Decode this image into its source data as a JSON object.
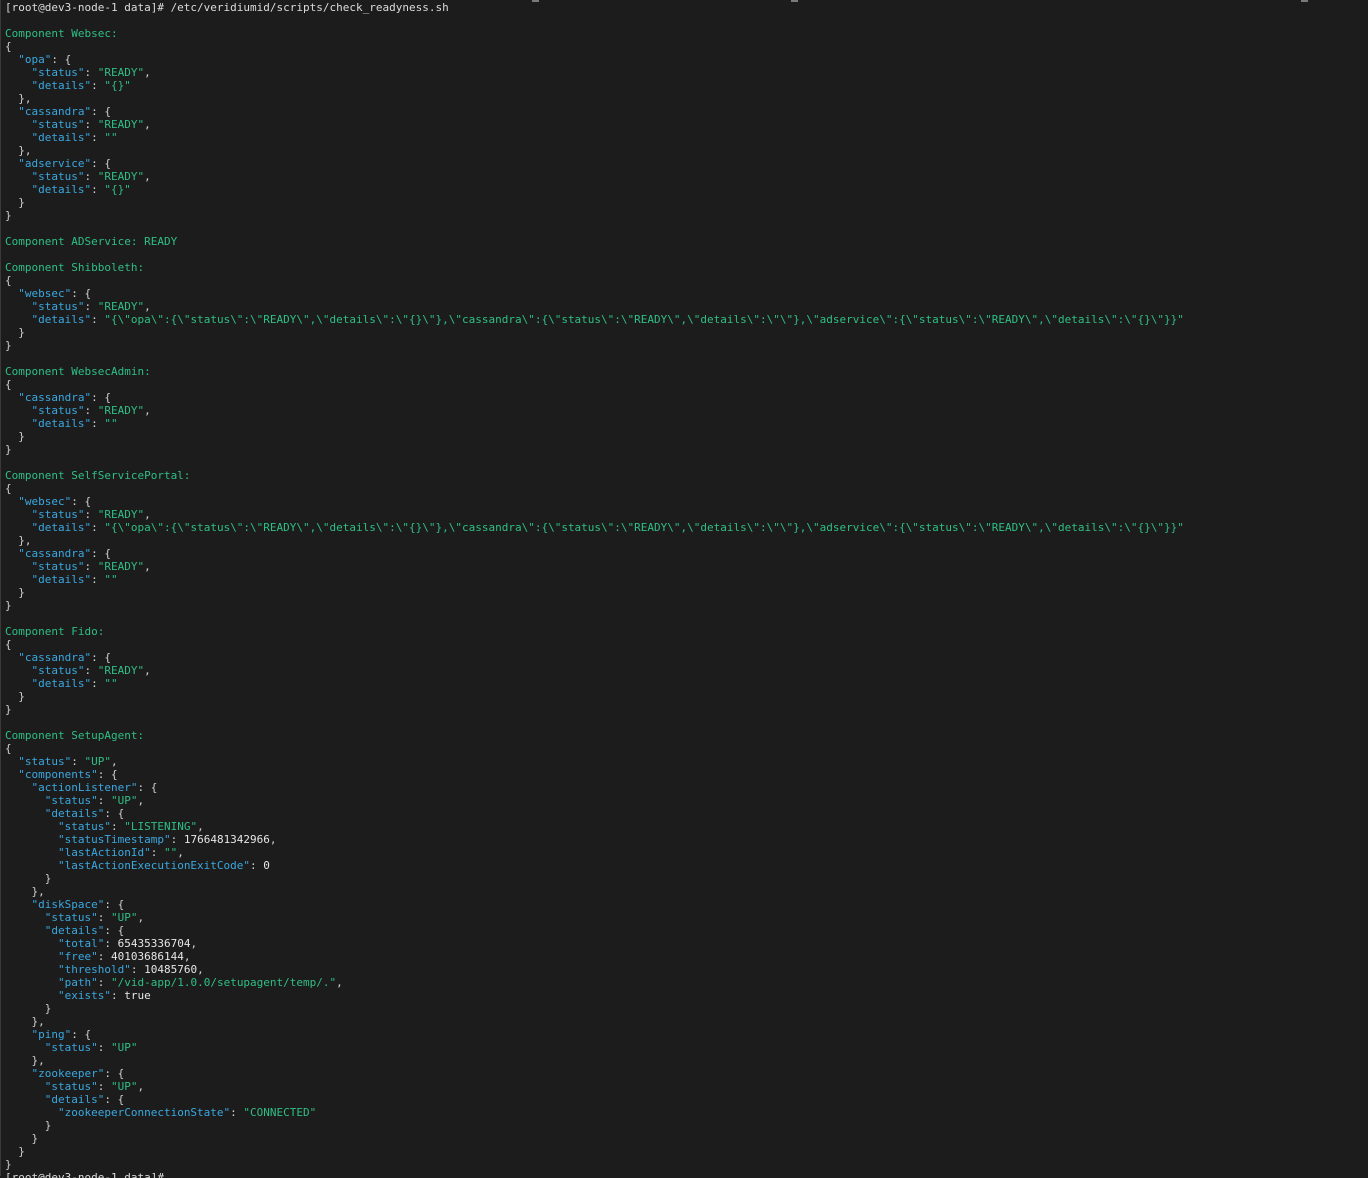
{
  "terminal": {
    "lines": [
      [
        [
          "prompt",
          "[root@dev3-node-1 data]# /etc/veridiumid/scripts/check_readyness.sh"
        ]
      ],
      [],
      [
        [
          "c",
          "Component Websec:"
        ]
      ],
      [
        [
          "p",
          "{"
        ]
      ],
      [
        [
          "p",
          "  "
        ],
        [
          "k",
          "\"opa\""
        ],
        [
          "p",
          ": {"
        ]
      ],
      [
        [
          "p",
          "    "
        ],
        [
          "k",
          "\"status\""
        ],
        [
          "p",
          ": "
        ],
        [
          "s",
          "\"READY\""
        ],
        [
          "p",
          ","
        ]
      ],
      [
        [
          "p",
          "    "
        ],
        [
          "k",
          "\"details\""
        ],
        [
          "p",
          ": "
        ],
        [
          "s",
          "\"{}\""
        ]
      ],
      [
        [
          "p",
          "  },"
        ]
      ],
      [
        [
          "p",
          "  "
        ],
        [
          "k",
          "\"cassandra\""
        ],
        [
          "p",
          ": {"
        ]
      ],
      [
        [
          "p",
          "    "
        ],
        [
          "k",
          "\"status\""
        ],
        [
          "p",
          ": "
        ],
        [
          "s",
          "\"READY\""
        ],
        [
          "p",
          ","
        ]
      ],
      [
        [
          "p",
          "    "
        ],
        [
          "k",
          "\"details\""
        ],
        [
          "p",
          ": "
        ],
        [
          "s",
          "\"\""
        ]
      ],
      [
        [
          "p",
          "  },"
        ]
      ],
      [
        [
          "p",
          "  "
        ],
        [
          "k",
          "\"adservice\""
        ],
        [
          "p",
          ": {"
        ]
      ],
      [
        [
          "p",
          "    "
        ],
        [
          "k",
          "\"status\""
        ],
        [
          "p",
          ": "
        ],
        [
          "s",
          "\"READY\""
        ],
        [
          "p",
          ","
        ]
      ],
      [
        [
          "p",
          "    "
        ],
        [
          "k",
          "\"details\""
        ],
        [
          "p",
          ": "
        ],
        [
          "s",
          "\"{}\""
        ]
      ],
      [
        [
          "p",
          "  }"
        ]
      ],
      [
        [
          "p",
          "}"
        ]
      ],
      [],
      [
        [
          "c",
          "Component ADService: READY"
        ]
      ],
      [],
      [
        [
          "c",
          "Component Shibboleth:"
        ]
      ],
      [
        [
          "p",
          "{"
        ]
      ],
      [
        [
          "p",
          "  "
        ],
        [
          "k",
          "\"websec\""
        ],
        [
          "p",
          ": {"
        ]
      ],
      [
        [
          "p",
          "    "
        ],
        [
          "k",
          "\"status\""
        ],
        [
          "p",
          ": "
        ],
        [
          "s",
          "\"READY\""
        ],
        [
          "p",
          ","
        ]
      ],
      [
        [
          "p",
          "    "
        ],
        [
          "k",
          "\"details\""
        ],
        [
          "p",
          ": "
        ],
        [
          "s",
          "\"{\\\"opa\\\":{\\\"status\\\":\\\"READY\\\",\\\"details\\\":\\\"{}\\\"},\\\"cassandra\\\":{\\\"status\\\":\\\"READY\\\",\\\"details\\\":\\\"\\\"},\\\"adservice\\\":{\\\"status\\\":\\\"READY\\\",\\\"details\\\":\\\"{}\\\"}}\""
        ]
      ],
      [
        [
          "p",
          "  }"
        ]
      ],
      [
        [
          "p",
          "}"
        ]
      ],
      [],
      [
        [
          "c",
          "Component WebsecAdmin:"
        ]
      ],
      [
        [
          "p",
          "{"
        ]
      ],
      [
        [
          "p",
          "  "
        ],
        [
          "k",
          "\"cassandra\""
        ],
        [
          "p",
          ": {"
        ]
      ],
      [
        [
          "p",
          "    "
        ],
        [
          "k",
          "\"status\""
        ],
        [
          "p",
          ": "
        ],
        [
          "s",
          "\"READY\""
        ],
        [
          "p",
          ","
        ]
      ],
      [
        [
          "p",
          "    "
        ],
        [
          "k",
          "\"details\""
        ],
        [
          "p",
          ": "
        ],
        [
          "s",
          "\"\""
        ]
      ],
      [
        [
          "p",
          "  }"
        ]
      ],
      [
        [
          "p",
          "}"
        ]
      ],
      [],
      [
        [
          "c",
          "Component SelfServicePortal:"
        ]
      ],
      [
        [
          "p",
          "{"
        ]
      ],
      [
        [
          "p",
          "  "
        ],
        [
          "k",
          "\"websec\""
        ],
        [
          "p",
          ": {"
        ]
      ],
      [
        [
          "p",
          "    "
        ],
        [
          "k",
          "\"status\""
        ],
        [
          "p",
          ": "
        ],
        [
          "s",
          "\"READY\""
        ],
        [
          "p",
          ","
        ]
      ],
      [
        [
          "p",
          "    "
        ],
        [
          "k",
          "\"details\""
        ],
        [
          "p",
          ": "
        ],
        [
          "s",
          "\"{\\\"opa\\\":{\\\"status\\\":\\\"READY\\\",\\\"details\\\":\\\"{}\\\"},\\\"cassandra\\\":{\\\"status\\\":\\\"READY\\\",\\\"details\\\":\\\"\\\"},\\\"adservice\\\":{\\\"status\\\":\\\"READY\\\",\\\"details\\\":\\\"{}\\\"}}\""
        ]
      ],
      [
        [
          "p",
          "  },"
        ]
      ],
      [
        [
          "p",
          "  "
        ],
        [
          "k",
          "\"cassandra\""
        ],
        [
          "p",
          ": {"
        ]
      ],
      [
        [
          "p",
          "    "
        ],
        [
          "k",
          "\"status\""
        ],
        [
          "p",
          ": "
        ],
        [
          "s",
          "\"READY\""
        ],
        [
          "p",
          ","
        ]
      ],
      [
        [
          "p",
          "    "
        ],
        [
          "k",
          "\"details\""
        ],
        [
          "p",
          ": "
        ],
        [
          "s",
          "\"\""
        ]
      ],
      [
        [
          "p",
          "  }"
        ]
      ],
      [
        [
          "p",
          "}"
        ]
      ],
      [],
      [
        [
          "c",
          "Component Fido:"
        ]
      ],
      [
        [
          "p",
          "{"
        ]
      ],
      [
        [
          "p",
          "  "
        ],
        [
          "k",
          "\"cassandra\""
        ],
        [
          "p",
          ": {"
        ]
      ],
      [
        [
          "p",
          "    "
        ],
        [
          "k",
          "\"status\""
        ],
        [
          "p",
          ": "
        ],
        [
          "s",
          "\"READY\""
        ],
        [
          "p",
          ","
        ]
      ],
      [
        [
          "p",
          "    "
        ],
        [
          "k",
          "\"details\""
        ],
        [
          "p",
          ": "
        ],
        [
          "s",
          "\"\""
        ]
      ],
      [
        [
          "p",
          "  }"
        ]
      ],
      [
        [
          "p",
          "}"
        ]
      ],
      [],
      [
        [
          "c",
          "Component SetupAgent:"
        ]
      ],
      [
        [
          "p",
          "{"
        ]
      ],
      [
        [
          "p",
          "  "
        ],
        [
          "k",
          "\"status\""
        ],
        [
          "p",
          ": "
        ],
        [
          "s",
          "\"UP\""
        ],
        [
          "p",
          ","
        ]
      ],
      [
        [
          "p",
          "  "
        ],
        [
          "k",
          "\"components\""
        ],
        [
          "p",
          ": {"
        ]
      ],
      [
        [
          "p",
          "    "
        ],
        [
          "k",
          "\"actionListener\""
        ],
        [
          "p",
          ": {"
        ]
      ],
      [
        [
          "p",
          "      "
        ],
        [
          "k",
          "\"status\""
        ],
        [
          "p",
          ": "
        ],
        [
          "s",
          "\"UP\""
        ],
        [
          "p",
          ","
        ]
      ],
      [
        [
          "p",
          "      "
        ],
        [
          "k",
          "\"details\""
        ],
        [
          "p",
          ": {"
        ]
      ],
      [
        [
          "p",
          "        "
        ],
        [
          "k",
          "\"status\""
        ],
        [
          "p",
          ": "
        ],
        [
          "s",
          "\"LISTENING\""
        ],
        [
          "p",
          ","
        ]
      ],
      [
        [
          "p",
          "        "
        ],
        [
          "k",
          "\"statusTimestamp\""
        ],
        [
          "p",
          ": "
        ],
        [
          "n",
          "1766481342966"
        ],
        [
          "p",
          ","
        ]
      ],
      [
        [
          "p",
          "        "
        ],
        [
          "k",
          "\"lastActionId\""
        ],
        [
          "p",
          ": "
        ],
        [
          "s",
          "\"\""
        ],
        [
          "p",
          ","
        ]
      ],
      [
        [
          "p",
          "        "
        ],
        [
          "k",
          "\"lastActionExecutionExitCode\""
        ],
        [
          "p",
          ": "
        ],
        [
          "n",
          "0"
        ]
      ],
      [
        [
          "p",
          "      }"
        ]
      ],
      [
        [
          "p",
          "    },"
        ]
      ],
      [
        [
          "p",
          "    "
        ],
        [
          "k",
          "\"diskSpace\""
        ],
        [
          "p",
          ": {"
        ]
      ],
      [
        [
          "p",
          "      "
        ],
        [
          "k",
          "\"status\""
        ],
        [
          "p",
          ": "
        ],
        [
          "s",
          "\"UP\""
        ],
        [
          "p",
          ","
        ]
      ],
      [
        [
          "p",
          "      "
        ],
        [
          "k",
          "\"details\""
        ],
        [
          "p",
          ": {"
        ]
      ],
      [
        [
          "p",
          "        "
        ],
        [
          "k",
          "\"total\""
        ],
        [
          "p",
          ": "
        ],
        [
          "n",
          "65435336704"
        ],
        [
          "p",
          ","
        ]
      ],
      [
        [
          "p",
          "        "
        ],
        [
          "k",
          "\"free\""
        ],
        [
          "p",
          ": "
        ],
        [
          "n",
          "40103686144"
        ],
        [
          "p",
          ","
        ]
      ],
      [
        [
          "p",
          "        "
        ],
        [
          "k",
          "\"threshold\""
        ],
        [
          "p",
          ": "
        ],
        [
          "n",
          "10485760"
        ],
        [
          "p",
          ","
        ]
      ],
      [
        [
          "p",
          "        "
        ],
        [
          "k",
          "\"path\""
        ],
        [
          "p",
          ": "
        ],
        [
          "s",
          "\"/vid-app/1.0.0/setupagent/temp/.\""
        ],
        [
          "p",
          ","
        ]
      ],
      [
        [
          "p",
          "        "
        ],
        [
          "k",
          "\"exists\""
        ],
        [
          "p",
          ": "
        ],
        [
          "n",
          "true"
        ]
      ],
      [
        [
          "p",
          "      }"
        ]
      ],
      [
        [
          "p",
          "    },"
        ]
      ],
      [
        [
          "p",
          "    "
        ],
        [
          "k",
          "\"ping\""
        ],
        [
          "p",
          ": {"
        ]
      ],
      [
        [
          "p",
          "      "
        ],
        [
          "k",
          "\"status\""
        ],
        [
          "p",
          ": "
        ],
        [
          "s",
          "\"UP\""
        ]
      ],
      [
        [
          "p",
          "    },"
        ]
      ],
      [
        [
          "p",
          "    "
        ],
        [
          "k",
          "\"zookeeper\""
        ],
        [
          "p",
          ": {"
        ]
      ],
      [
        [
          "p",
          "      "
        ],
        [
          "k",
          "\"status\""
        ],
        [
          "p",
          ": "
        ],
        [
          "s",
          "\"UP\""
        ],
        [
          "p",
          ","
        ]
      ],
      [
        [
          "p",
          "      "
        ],
        [
          "k",
          "\"details\""
        ],
        [
          "p",
          ": {"
        ]
      ],
      [
        [
          "p",
          "        "
        ],
        [
          "k",
          "\"zookeeperConnectionState\""
        ],
        [
          "p",
          ": "
        ],
        [
          "s",
          "\"CONNECTED\""
        ]
      ],
      [
        [
          "p",
          "      }"
        ]
      ],
      [
        [
          "p",
          "    }"
        ]
      ],
      [
        [
          "p",
          "  }"
        ]
      ],
      [
        [
          "p",
          "}"
        ]
      ],
      [
        [
          "prompt",
          "[root@dev3-node-1 data]# "
        ]
      ]
    ]
  }
}
